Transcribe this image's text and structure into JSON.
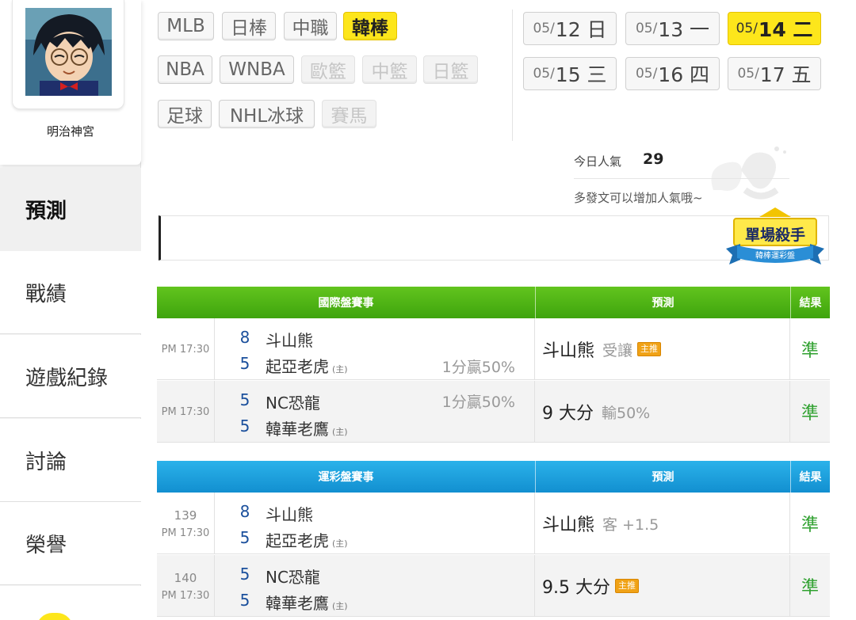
{
  "profile": {
    "username": "明治神宮"
  },
  "nav": [
    {
      "label": "預測",
      "active": true
    },
    {
      "label": "戰績"
    },
    {
      "label": "遊戲紀錄"
    },
    {
      "label": "討論"
    },
    {
      "label": "榮譽"
    }
  ],
  "sports": {
    "row1": [
      "MLB",
      "日棒",
      "中職",
      "韓棒"
    ],
    "row2": [
      "NBA",
      "WNBA",
      "歐籃",
      "中籃",
      "日籃"
    ],
    "row3": [
      "足球",
      "NHL冰球",
      "賽馬"
    ],
    "active": "韓棒"
  },
  "dates": [
    {
      "md": "05/",
      "day": "12 日"
    },
    {
      "md": "05/",
      "day": "13 一"
    },
    {
      "md": "05/",
      "day": "14 二",
      "active": true
    },
    {
      "md": "05/",
      "day": "15 三"
    },
    {
      "md": "05/",
      "day": "16 四"
    },
    {
      "md": "05/",
      "day": "17 五"
    }
  ],
  "popularity": {
    "label": "今日人氣",
    "value": "29",
    "hint": "多發文可以增加人氣哦~"
  },
  "badge": {
    "title": "單場殺手",
    "subtitle": "韓棒運彩盤"
  },
  "intl": {
    "headers": {
      "game": "國際盤賽事",
      "pred": "預測",
      "result": "結果"
    },
    "rows": [
      {
        "time": "PM 17:30",
        "s1": "8",
        "t1": "斗山熊",
        "s2": "5",
        "t2": "起亞老虎",
        "home": "(主)",
        "odds": "1分贏50%",
        "pred": "斗山熊",
        "pred_sub": "受讓",
        "tag": "主推",
        "result": "準"
      },
      {
        "time": "PM 17:30",
        "s1": "5",
        "t1": "NC恐龍",
        "s2": "5",
        "t2": "韓華老鷹",
        "home": "(主)",
        "odds": "1分贏50%",
        "pred": "9 大分",
        "pred_sub": "輸50%",
        "result": "準"
      }
    ]
  },
  "sportslottery": {
    "headers": {
      "game": "運彩盤賽事",
      "pred": "預測",
      "result": "結果"
    },
    "rows": [
      {
        "num": "139",
        "time": "PM 17:30",
        "s1": "8",
        "t1": "斗山熊",
        "s2": "5",
        "t2": "起亞老虎",
        "home": "(主)",
        "pred": "斗山熊",
        "pred_sub": "客 +1.5",
        "result": "準"
      },
      {
        "num": "140",
        "time": "PM 17:30",
        "s1": "5",
        "t1": "NC恐龍",
        "s2": "5",
        "t2": "韓華老鷹",
        "home": "(主)",
        "pred": "9.5 大分",
        "tag": "主推",
        "result": "準"
      }
    ]
  },
  "colors": {
    "accent": "#fde61b",
    "green_header": "#4cb014",
    "blue_header": "#1ea0dc",
    "result": "#2ea02e"
  }
}
